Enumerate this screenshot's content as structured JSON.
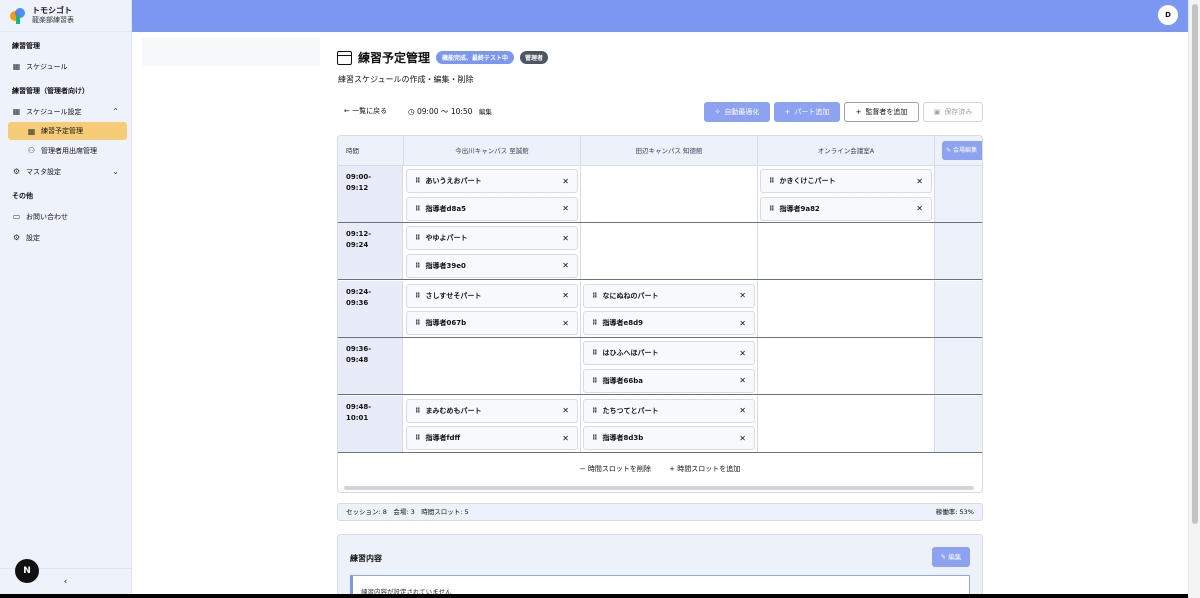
{
  "brand": {
    "name": "トモシゴト",
    "subtitle": "龍楽部練習表"
  },
  "sidebar": {
    "section1": "練習管理",
    "schedule": "スケジュール",
    "section2": "練習管理（管理者向け）",
    "schedule_settings": "スケジュール設定",
    "practice_plan": "練習予定管理",
    "director_attendance": "管理者用出席管理",
    "master_settings": "マスタ設定",
    "section3": "その他",
    "contact": "お問い合わせ",
    "settings": "設定",
    "collapse": "‹"
  },
  "next_badge": "N",
  "user_avatar": "D",
  "page": {
    "title": "練習予定管理",
    "tag_status": "機能完成、最終テスト中",
    "tag_role": "管理者",
    "subtitle": "練習スケジュールの作成・編集・削除"
  },
  "toolbar": {
    "back": "← 一覧に戻る",
    "time_range": "09:00 〜 10:50",
    "time_edit": "編集",
    "auto_optimize": "自動最適化",
    "add_part": "パート追加",
    "add_director": "監督者を追加",
    "save": "保存済み"
  },
  "grid": {
    "time_header": "時間",
    "venues": [
      "今出川キャンパス 至誠館",
      "田辺キャンパス 知徳館",
      "オンライン会議室A"
    ],
    "venue_edit": "会場編集",
    "rows": [
      {
        "time": "09:00-\n09:12",
        "cells": [
          [
            "あいうえおパート",
            "指導者d8a5"
          ],
          [],
          [
            "かきくけこパート",
            "指導者9a82"
          ]
        ]
      },
      {
        "time": "09:12-\n09:24",
        "cells": [
          [
            "やゆよパート",
            "指導者39e0"
          ],
          [],
          []
        ]
      },
      {
        "time": "09:24-\n09:36",
        "cells": [
          [
            "さしすせそパート",
            "指導者067b"
          ],
          [
            "なにぬねのパート",
            "指導者e8d9"
          ],
          []
        ]
      },
      {
        "time": "09:36-\n09:48",
        "cells": [
          [],
          [
            "はひふへほパート",
            "指導者66ba"
          ],
          []
        ]
      },
      {
        "time": "09:48-\n10:01",
        "cells": [
          [
            "まみむめもパート",
            "指導者fdff"
          ],
          [
            "たちつてとパート",
            "指導者8d3b"
          ],
          []
        ]
      }
    ],
    "remove_slot": "− 時間スロットを削除",
    "add_slot": "+ 時間スロットを追加"
  },
  "stats": {
    "summary": "セッション: 8　会場: 3　時間スロット: 5",
    "rate": "稼働率: 53%"
  },
  "practice": {
    "title": "練習内容",
    "edit": "編集",
    "empty": "練習内容が設定されていません"
  },
  "colors": {
    "accent": "#7c97f2",
    "active_nav": "#f6cc79",
    "panel": "#edf1fa"
  }
}
